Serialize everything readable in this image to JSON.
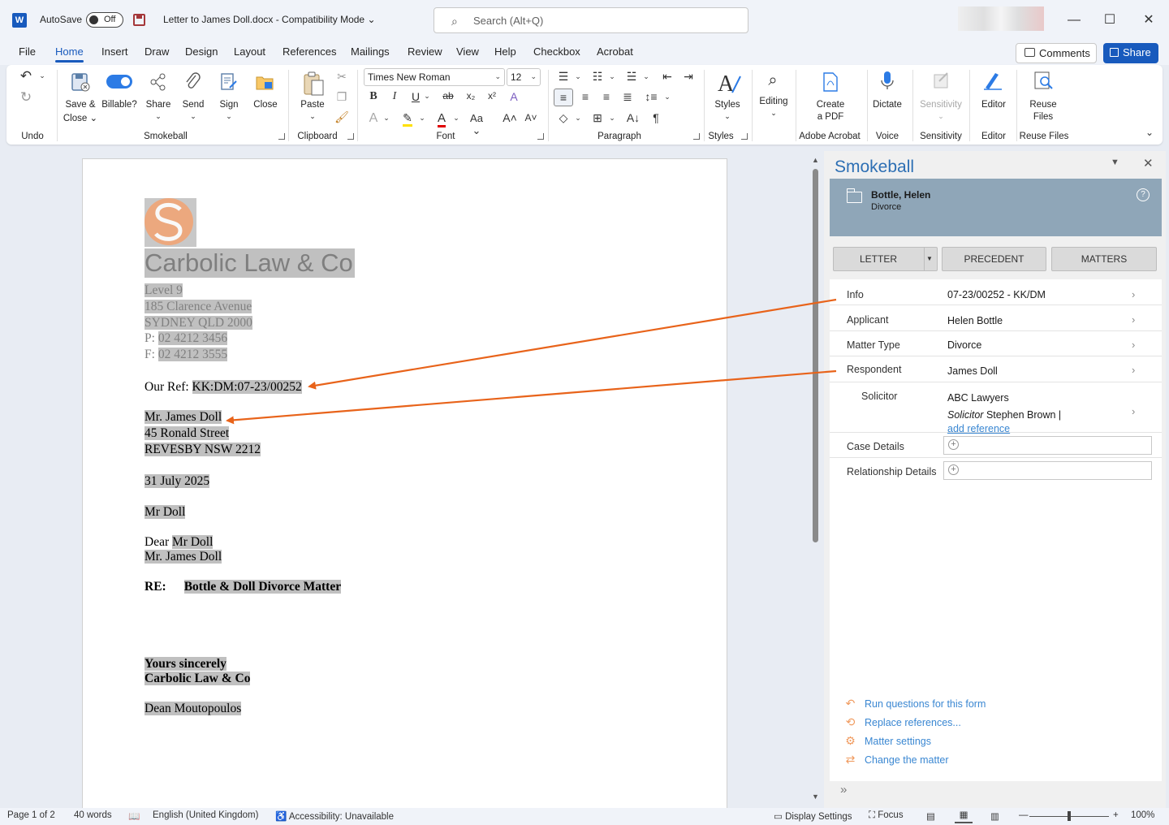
{
  "titlebar": {
    "app_logo": "W",
    "autosave_label": "AutoSave",
    "autosave_state": "Off",
    "document_title": "Letter to James Doll.docx  -  Compatibility Mode",
    "search_placeholder": "Search (Alt+Q)"
  },
  "menu": {
    "tabs": [
      "File",
      "Home",
      "Insert",
      "Draw",
      "Design",
      "Layout",
      "References",
      "Mailings",
      "Review",
      "View",
      "Help",
      "Checkbox",
      "Acrobat"
    ],
    "active_tab": "Home",
    "comments_label": "Comments",
    "share_label": "Share"
  },
  "ribbon": {
    "undo_group": "Undo",
    "smokeball": {
      "save_close": "Save &",
      "save_close2": "Close",
      "billable": "Billable?",
      "share": "Share",
      "send": "Send",
      "sign": "Sign",
      "close": "Close",
      "group": "Smokeball"
    },
    "clipboard": {
      "paste": "Paste",
      "group": "Clipboard"
    },
    "font": {
      "family": "Times New Roman",
      "size": "12",
      "group": "Font"
    },
    "paragraph": {
      "group": "Paragraph"
    },
    "styles": {
      "label": "Styles",
      "group": "Styles"
    },
    "editing": {
      "label": "Editing"
    },
    "acrobat": {
      "label1": "Create",
      "label2": "a PDF",
      "group": "Adobe Acrobat"
    },
    "voice": {
      "label": "Dictate",
      "group": "Voice"
    },
    "sensitivity": {
      "label": "Sensitivity",
      "group": "Sensitivity"
    },
    "editor": {
      "label": "Editor",
      "group": "Editor"
    },
    "reuse": {
      "label1": "Reuse",
      "label2": "Files",
      "group": "Reuse Files"
    }
  },
  "document": {
    "firm_name": "Carbolic Law & Co",
    "address": [
      "Level 9",
      "185 Clarence Avenue",
      "SYDNEY QLD 2000"
    ],
    "phone_prefix": "P: ",
    "phone": "02 4212 3456",
    "fax_prefix": "F: ",
    "fax": "02 4212 3555",
    "our_ref_label": "Our Ref: ",
    "our_ref": "KK:DM:07-23/00252",
    "recipient": [
      "Mr. James Doll",
      "45 Ronald Street",
      "REVESBY NSW 2212"
    ],
    "date": "31 July 2025",
    "salutation_name": "Mr Doll",
    "dear_prefix": "Dear ",
    "dear_name": "Mr Doll",
    "dear_full": "Mr. James Doll",
    "re_label": "RE:",
    "re_text": "Bottle & Doll Divorce Matter",
    "closing": "Yours sincerely",
    "closing_firm": "Carbolic Law & Co",
    "signatory": "Dean Moutopoulos"
  },
  "pane": {
    "title": "Smokeball",
    "matter_name": "Bottle, Helen",
    "matter_type": "Divorce",
    "buttons": [
      "LETTER",
      "PRECEDENT",
      "MATTERS"
    ],
    "rows": [
      {
        "label": "Info",
        "value": "07-23/00252 - KK/DM"
      },
      {
        "label": "Applicant",
        "value": "Helen Bottle"
      },
      {
        "label": "Matter Type",
        "value": "Divorce"
      },
      {
        "label": "Respondent",
        "value": "James Doll"
      }
    ],
    "solicitor": {
      "label": "Solicitor",
      "firm": "ABC Lawyers",
      "role": "Solicitor",
      "person": "Stephen Brown |",
      "add_reference": "add reference"
    },
    "case_details": "Case Details",
    "relationship_details": "Relationship Details",
    "links": [
      "Run questions for this form",
      "Replace references...",
      "Matter settings",
      "Change the matter"
    ]
  },
  "status": {
    "page": "Page 1 of 2",
    "words": "40 words",
    "language": "English (United Kingdom)",
    "accessibility": "Accessibility: Unavailable",
    "display_settings": "Display Settings",
    "focus": "Focus",
    "zoom": "100%"
  },
  "colors": {
    "accent": "#185abd",
    "arrow": "#e8631a",
    "pane_link": "#3a87d2",
    "matter_card": "#8fa6b8"
  }
}
